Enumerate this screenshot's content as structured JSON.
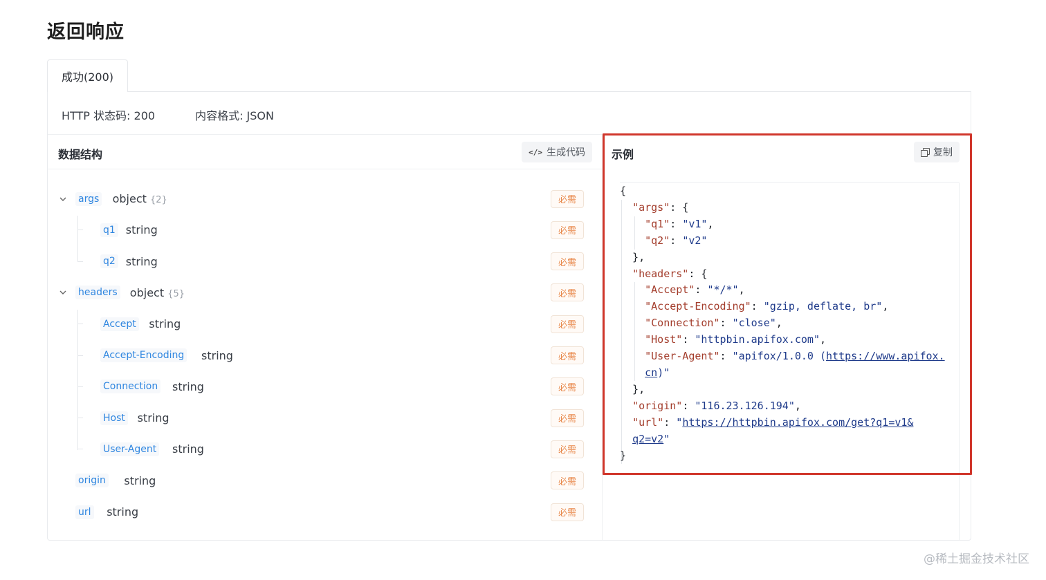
{
  "page_title": "返回响应",
  "tab": {
    "label": "成功(200)"
  },
  "meta": {
    "status": "HTTP 状态码: 200",
    "format": "内容格式: JSON"
  },
  "schema": {
    "title": "数据结构",
    "gen_code_label": "生成代码",
    "required_label": "必需",
    "fields": [
      {
        "name": "args",
        "type": "object",
        "count": "{2}",
        "expandable": true
      },
      {
        "name": "q1",
        "type": "string"
      },
      {
        "name": "q2",
        "type": "string"
      },
      {
        "name": "headers",
        "type": "object",
        "count": "{5}",
        "expandable": true
      },
      {
        "name": "Accept",
        "type": "string"
      },
      {
        "name": "Accept-Encoding",
        "type": "string"
      },
      {
        "name": "Connection",
        "type": "string"
      },
      {
        "name": "Host",
        "type": "string"
      },
      {
        "name": "User-Agent",
        "type": "string"
      },
      {
        "name": "origin",
        "type": "string"
      },
      {
        "name": "url",
        "type": "string"
      }
    ]
  },
  "example": {
    "title": "示例",
    "copy_label": "复制",
    "json": {
      "args": {
        "q1": "v1",
        "q2": "v2"
      },
      "headers": {
        "Accept": "*/*",
        "Accept-Encoding": "gzip, deflate, br",
        "Connection": "close",
        "Host": "httpbin.apifox.com",
        "User-Agent": "apifox/1.0.0 (https://www.apifox.cn)"
      },
      "origin": "116.23.126.194",
      "url": "https://httpbin.apifox.com/get?q1=v1&q2=v2"
    }
  },
  "watermark": "@稀土掘金技术社区",
  "colors": {
    "field_name": "#2f86e0",
    "required": "#e8884a",
    "highlight_border": "#d0362b"
  }
}
